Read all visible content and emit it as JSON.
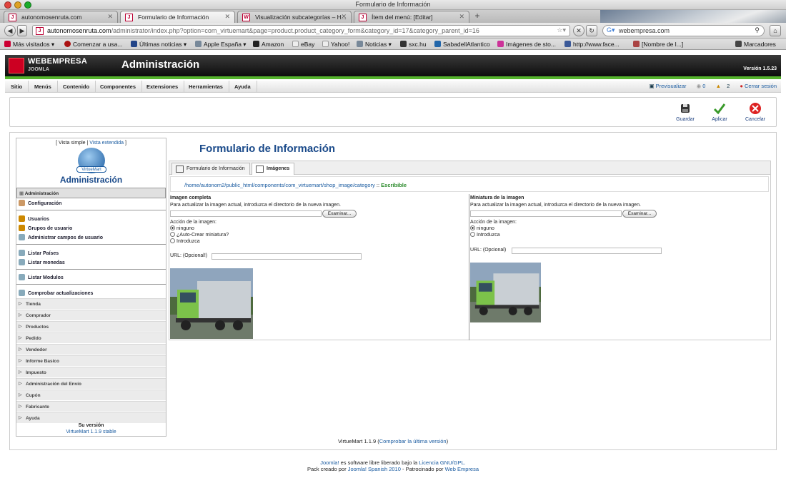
{
  "window": {
    "title": "Formulario de Información"
  },
  "tabs": [
    {
      "label": "autonomosenruta.com"
    },
    {
      "label": "Formulario de Información"
    },
    {
      "label": "Visualización subcategorías – H..."
    },
    {
      "label": "Ítem del menú: [Editar]"
    }
  ],
  "url": {
    "domain": "autonomosenruta.com",
    "path": "/administrator/index.php?option=com_virtuemart&page=product.product_category_form&category_id=17&category_parent_id=16"
  },
  "search": {
    "value": "webempresa.com"
  },
  "bookmarks": [
    "Más visitados",
    "Comenzar a usa...",
    "Últimas noticias",
    "Apple España",
    "Amazon",
    "eBay",
    "Yahoo!",
    "Noticias",
    "sxc.hu",
    "SabadellAtlantico",
    "Imágenes de sto...",
    "http://www.face...",
    "[Nombre de l...]",
    "Marcadores"
  ],
  "header": {
    "brand": "WEBEMPRESA",
    "brand_sub": "JOOMLA",
    "title": "Administración",
    "version": "Versión 1.5.23"
  },
  "menu": [
    "Sitio",
    "Menús",
    "Contenido",
    "Componentes",
    "Extensiones",
    "Herramientas",
    "Ayuda"
  ],
  "status": {
    "preview": "Previsualizar",
    "count1": "0",
    "count2": "2",
    "logout": "Cerrar sesión"
  },
  "toolbar": {
    "save": "Guardar",
    "apply": "Aplicar",
    "cancel": "Cancelar"
  },
  "sidebar": {
    "view_simple": "Vista simple",
    "view_extended": "Vista extendida",
    "logo_text": "VirtueMart",
    "title": "Administración",
    "active": "Administración",
    "items1": [
      "Configuración"
    ],
    "items2": [
      "Usuarios",
      "Grupos de usuario",
      "Administrar campos de usuario"
    ],
    "items3": [
      "Listar Países",
      "Listar monedas"
    ],
    "items4": [
      "Listar Modulos"
    ],
    "items5": [
      "Comprobar actualizaciones"
    ],
    "accordions": [
      "Tienda",
      "Comprador",
      "Productos",
      "Pedido",
      "Vendedor",
      "Informe Basico",
      "Impuesto",
      "Administración del Envío",
      "Cupón",
      "Fabricante",
      "Ayuda"
    ],
    "version_label": "Su versión",
    "version_value": "VirtueMart 1.1.9 stable"
  },
  "content": {
    "title": "Formulario de Información",
    "tab_info": "Formulario de Información",
    "tab_images": "Imágenes",
    "path": "/home/autonom2/public_html/components/com_virtuemart/shop_image/category",
    "path_sep": " :: ",
    "writable": "Escribible",
    "full": {
      "heading": "Imagen completa",
      "hint": "Para actualizar la imagen actual, introduzca el directorio de la nueva imagen.",
      "browse": "Examinar...",
      "action_label": "Acción de la imagen:",
      "options": [
        "ninguno",
        "¿Auto-Crear miniatura?",
        "Introduzca"
      ],
      "url_label": "URL: (Opcional!)"
    },
    "thumb": {
      "heading": "Miniatura de la imagen",
      "hint": "Para actualizar la imagen actual, introduzca el directorio de la nueva imagen.",
      "browse": "Examinar...",
      "action_label": "Acción de la imagen:",
      "options": [
        "ninguno",
        "Introduzca"
      ],
      "url_label": "URL: (Opcional)"
    }
  },
  "footer": {
    "vm": "VirtueMart 1.1.9",
    "vm_link": "Comprobar la última versión",
    "j1_a": "Joomla!",
    "j1_b": " es software libre liberado bajo la ",
    "j1_c": "Licencia GNU/GPL.",
    "j2_a": "Pack creado por ",
    "j2_b": "Joomla! Spanish 2010",
    "j2_c": " - Patrocinado por ",
    "j2_d": "Web Empresa"
  },
  "colors": {
    "accent_green": "#55b32c",
    "link_blue": "#1a5ba0",
    "title_blue": "#1a4a8a"
  }
}
